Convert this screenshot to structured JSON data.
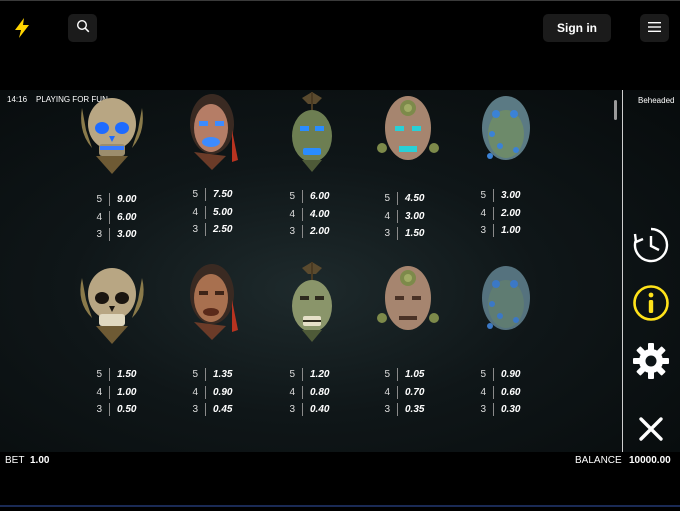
{
  "header": {
    "logo_icon": "lightning-bolt-icon",
    "search_icon": "search-icon",
    "signin_label": "Sign in",
    "menu_icon": "hamburger-menu-icon",
    "accent_color": "#FFD400"
  },
  "game": {
    "clock": "14:16",
    "mode": "PLAYING FOR FUN",
    "title": "Beheaded",
    "paytable": [
      {
        "symbol": "skull-icon",
        "pays": [
          {
            "count": "5",
            "value": "9.00"
          },
          {
            "count": "4",
            "value": "6.00"
          },
          {
            "count": "3",
            "value": "3.00"
          }
        ]
      },
      {
        "symbol": "tribal-head-icon",
        "pays": [
          {
            "count": "5",
            "value": "7.50"
          },
          {
            "count": "4",
            "value": "5.00"
          },
          {
            "count": "3",
            "value": "2.50"
          }
        ]
      },
      {
        "symbol": "shrunken-head-icon",
        "pays": [
          {
            "count": "5",
            "value": "6.00"
          },
          {
            "count": "4",
            "value": "4.00"
          },
          {
            "count": "3",
            "value": "2.00"
          }
        ]
      },
      {
        "symbol": "bald-head-icon",
        "pays": [
          {
            "count": "5",
            "value": "4.50"
          },
          {
            "count": "4",
            "value": "3.00"
          },
          {
            "count": "3",
            "value": "1.50"
          }
        ]
      },
      {
        "symbol": "zombie-head-icon",
        "pays": [
          {
            "count": "5",
            "value": "3.00"
          },
          {
            "count": "4",
            "value": "2.00"
          },
          {
            "count": "3",
            "value": "1.00"
          }
        ]
      },
      {
        "symbol": "skull-icon",
        "pays": [
          {
            "count": "5",
            "value": "1.50"
          },
          {
            "count": "4",
            "value": "1.00"
          },
          {
            "count": "3",
            "value": "0.50"
          }
        ]
      },
      {
        "symbol": "tribal-head-icon",
        "pays": [
          {
            "count": "5",
            "value": "1.35"
          },
          {
            "count": "4",
            "value": "0.90"
          },
          {
            "count": "3",
            "value": "0.45"
          }
        ]
      },
      {
        "symbol": "shrunken-head-icon",
        "pays": [
          {
            "count": "5",
            "value": "1.20"
          },
          {
            "count": "4",
            "value": "0.80"
          },
          {
            "count": "3",
            "value": "0.40"
          }
        ]
      },
      {
        "symbol": "bald-head-icon",
        "pays": [
          {
            "count": "5",
            "value": "1.05"
          },
          {
            "count": "4",
            "value": "0.70"
          },
          {
            "count": "3",
            "value": "0.35"
          }
        ]
      },
      {
        "symbol": "zombie-head-icon",
        "pays": [
          {
            "count": "5",
            "value": "0.90"
          },
          {
            "count": "4",
            "value": "0.60"
          },
          {
            "count": "3",
            "value": "0.30"
          }
        ]
      }
    ],
    "side_icons": [
      "history-clock-icon",
      "info-icon",
      "settings-gear-icon",
      "close-icon"
    ],
    "info_color": "#FFE21A"
  },
  "footer": {
    "bet_label": "BET",
    "bet_value": "1.00",
    "balance_label": "BALANCE",
    "balance_value": "10000.00"
  }
}
